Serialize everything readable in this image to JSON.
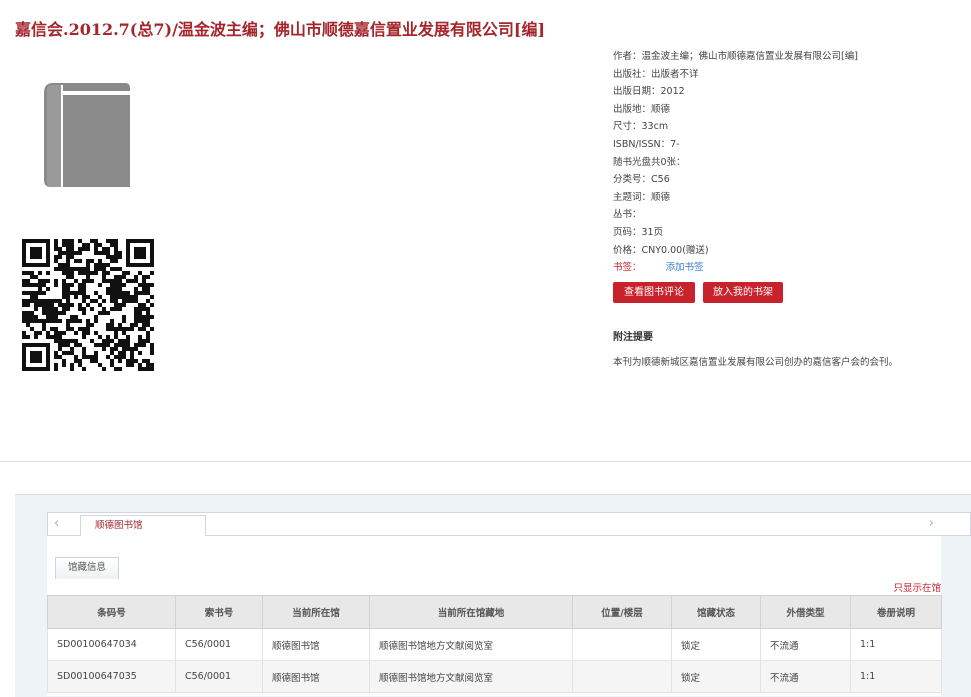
{
  "book": {
    "title": "嘉信会.2012.7(总7)/温金波主编；佛山市顺德嘉信置业发展有限公司[编]"
  },
  "details": [
    {
      "label": "作者：",
      "value": "温金波主编；佛山市顺德嘉信置业发展有限公司[编]"
    },
    {
      "label": "出版社：",
      "value": "出版者不详"
    },
    {
      "label": "出版日期：",
      "value": "2012"
    },
    {
      "label": "出版地：",
      "value": "顺德"
    },
    {
      "label": "尺寸：",
      "value": "33cm"
    },
    {
      "label": "ISBN/ISSN：",
      "value": "7-"
    },
    {
      "label": "随书光盘共0张：",
      "value": ""
    },
    {
      "label": "分类号：",
      "value": "C56"
    },
    {
      "label": "主题词：",
      "value": "顺德"
    },
    {
      "label": "丛书：",
      "value": ""
    },
    {
      "label": "页码：",
      "value": "31页"
    },
    {
      "label": "价格：",
      "value": "CNY0.00(赠送)"
    }
  ],
  "bookmark": {
    "label": "书签：",
    "link": "添加书签"
  },
  "buttons": {
    "review": "查看图书评论",
    "shelf": "放入我的书架"
  },
  "abstract": {
    "heading": "附注提要",
    "text": "本刊为顺德新城区嘉信置业发展有限公司创办的嘉信客户会的会刊。"
  },
  "library_tabs": {
    "active": "顺德图书馆",
    "prev_icon": "chevron-left-icon",
    "next_icon": "chevron-right-icon"
  },
  "holdings": {
    "subtab": "馆藏信息",
    "show_only": "只显示在馆",
    "columns": [
      "条码号",
      "索书号",
      "当前所在馆",
      "当前所在馆藏地",
      "位置/楼层",
      "馆藏状态",
      "外借类型",
      "卷册说明"
    ],
    "rows": [
      [
        "SD00100647034",
        "C56/0001",
        "顺德图书馆",
        "顺德图书馆地方文献阅览室",
        "",
        "锁定",
        "不流通",
        "1:1"
      ],
      [
        "SD00100647035",
        "C56/0001",
        "顺德图书馆",
        "顺德图书馆地方文献阅览室",
        "",
        "锁定",
        "不流通",
        "1:1"
      ]
    ]
  },
  "colors": {
    "accent": "#c8232c",
    "title": "#a3262c",
    "link": "#3a7cc8",
    "cover": "#8a8a8a"
  },
  "icons": {
    "cover": "book-icon",
    "qr": "qr-code-icon"
  }
}
